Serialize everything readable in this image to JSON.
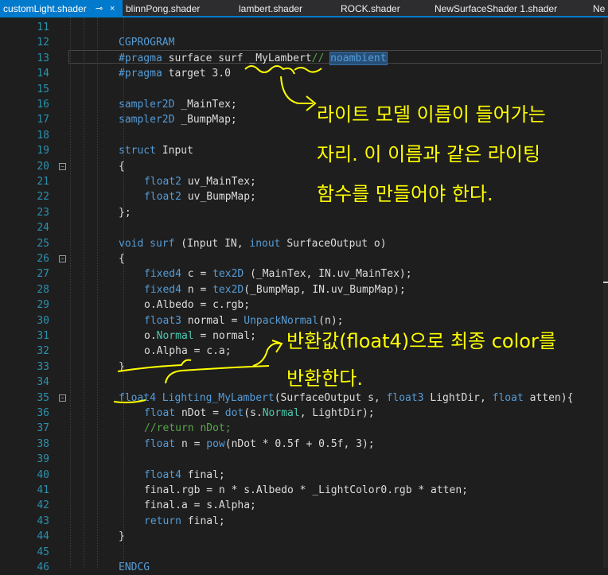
{
  "tabs": [
    {
      "label": "customLight.shader",
      "active": true,
      "pin": "⊸",
      "close": "×"
    },
    {
      "label": "blinnPong.shader"
    },
    {
      "label": "lambert.shader"
    },
    {
      "label": "ROCK.shader"
    },
    {
      "label": "NewSurfaceShader 1.shader"
    },
    {
      "label": "Ne"
    }
  ],
  "colors": {
    "keyword": "#569cd6",
    "type": "#4ec9b0",
    "comment": "#57a64a",
    "lineNumber": "#2b91af",
    "annotation": "#ffff00",
    "accent": "#007acc"
  },
  "lines": [
    {
      "n": "11",
      "code": ""
    },
    {
      "n": "12",
      "code": "CGPROGRAM"
    },
    {
      "n": "13",
      "code": "#pragma surface surf _MyLambert// noambient"
    },
    {
      "n": "14",
      "code": "#pragma target 3.0"
    },
    {
      "n": "15",
      "code": ""
    },
    {
      "n": "16",
      "code": "sampler2D _MainTex;"
    },
    {
      "n": "17",
      "code": "sampler2D _BumpMap;"
    },
    {
      "n": "18",
      "code": ""
    },
    {
      "n": "19",
      "code": "struct Input"
    },
    {
      "n": "20",
      "code": "{"
    },
    {
      "n": "21",
      "code": "float2 uv_MainTex;"
    },
    {
      "n": "22",
      "code": "float2 uv_BumpMap;"
    },
    {
      "n": "23",
      "code": "};"
    },
    {
      "n": "24",
      "code": ""
    },
    {
      "n": "25",
      "code": "void surf (Input IN, inout SurfaceOutput o)"
    },
    {
      "n": "26",
      "code": "{"
    },
    {
      "n": "27",
      "code": "fixed4 c = tex2D (_MainTex, IN.uv_MainTex);"
    },
    {
      "n": "28",
      "code": "fixed4 n = tex2D(_BumpMap, IN.uv_BumpMap);"
    },
    {
      "n": "29",
      "code": "o.Albedo = c.rgb;"
    },
    {
      "n": "30",
      "code": "float3 normal = UnpackNormal(n);"
    },
    {
      "n": "31",
      "code": "o.Normal = normal;"
    },
    {
      "n": "32",
      "code": "o.Alpha = c.a;"
    },
    {
      "n": "33",
      "code": "}"
    },
    {
      "n": "34",
      "code": ""
    },
    {
      "n": "35",
      "code": "float4 Lighting_MyLambert(SurfaceOutput s, float3 LightDir, float atten){"
    },
    {
      "n": "36",
      "code": "float nDot = dot(s.Normal, LightDir);"
    },
    {
      "n": "37",
      "code": "//return nDot;"
    },
    {
      "n": "38",
      "code": "float n = pow(nDot * 0.5f + 0.5f, 3);"
    },
    {
      "n": "39",
      "code": ""
    },
    {
      "n": "40",
      "code": "float4 final;"
    },
    {
      "n": "41",
      "code": "final.rgb = n * s.Albedo * _LightColor0.rgb * atten;"
    },
    {
      "n": "42",
      "code": "final.a = s.Alpha;"
    },
    {
      "n": "43",
      "code": "return final;"
    },
    {
      "n": "44",
      "code": "}"
    },
    {
      "n": "45",
      "code": ""
    },
    {
      "n": "46",
      "code": "ENDCG"
    }
  ],
  "annotations": {
    "a1": "라이트 모델 이름이 들어가는",
    "a2": "자리. 이 이름과 같은 라이팅",
    "a3": "함수를 만들어야 한다.",
    "b1": "반환값(float4)으로 최종 color를",
    "b2": "반환한다."
  }
}
